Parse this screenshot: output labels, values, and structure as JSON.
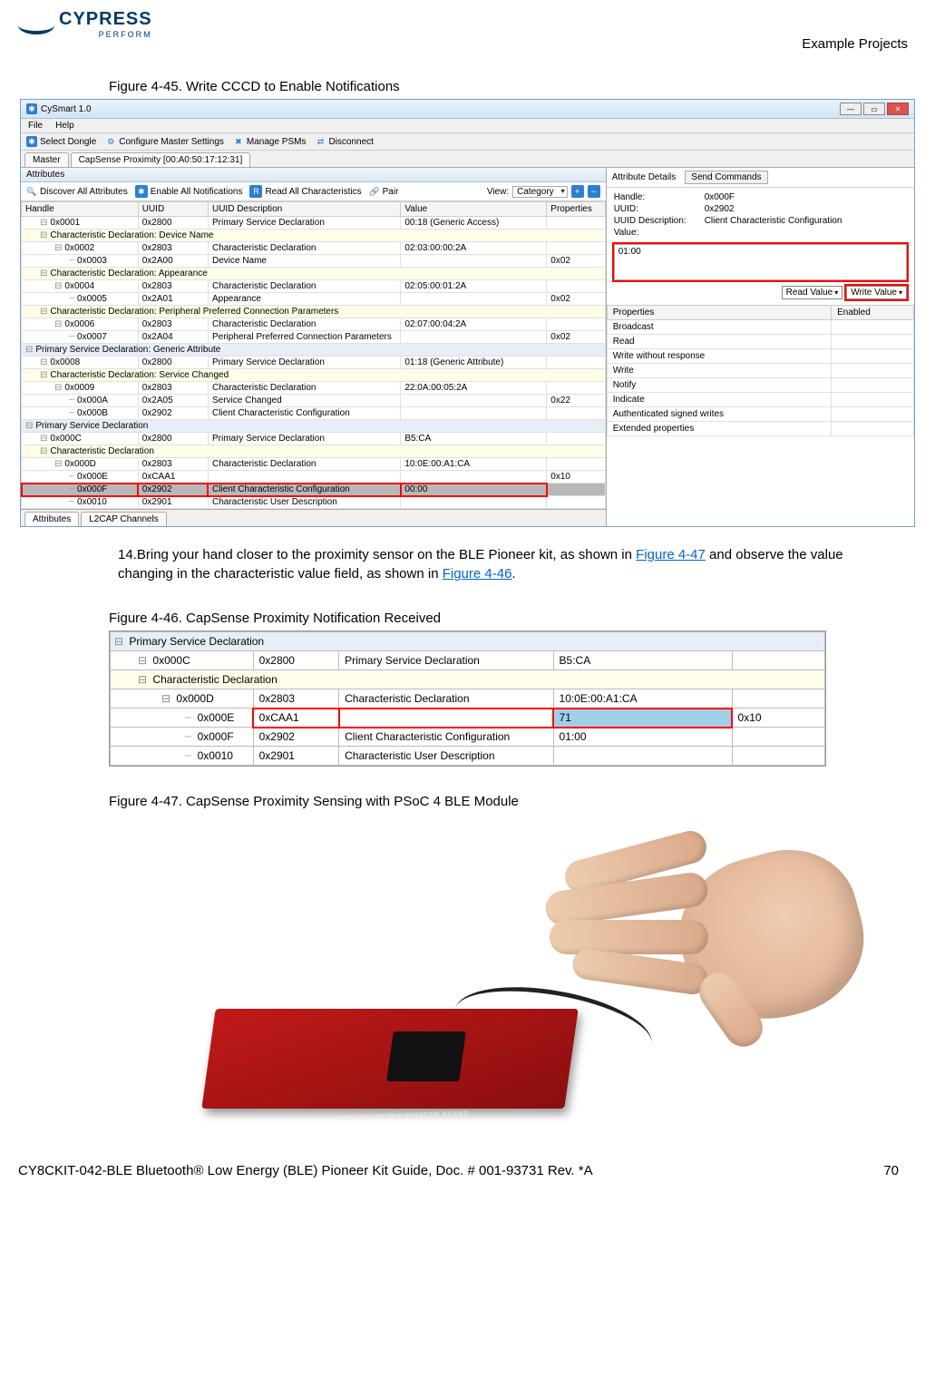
{
  "header": {
    "brand": "CYPRESS",
    "brand_sub": "PERFORM",
    "section": "Example Projects"
  },
  "figure45": {
    "caption": "Figure 4-45.  Write CCCD to Enable Notifications",
    "title": "CySmart 1.0",
    "menubar": [
      "File",
      "Help"
    ],
    "toolbar": [
      {
        "icon": "bluetooth-icon",
        "label": "Select Dongle"
      },
      {
        "icon": "gear-icon",
        "label": "Configure Master Settings"
      },
      {
        "icon": "tools-icon",
        "label": "Manage PSMs"
      },
      {
        "icon": "disconnect-icon",
        "label": "Disconnect"
      }
    ],
    "master_tabs": [
      "Master",
      "CapSense Proximity [00:A0:50:17:12:31]"
    ],
    "attributes_header": "Attributes",
    "attr_toolbar": [
      "Discover All Attributes",
      "Enable All Notifications",
      "Read All Characteristics",
      "Pair",
      "View:"
    ],
    "view_value": "Category",
    "columns": [
      "Handle",
      "UUID",
      "UUID Description",
      "Value",
      "Properties"
    ],
    "rows": [
      {
        "indent": 1,
        "group": false,
        "cells": [
          "0x0001",
          "0x2800",
          "Primary Service Declaration",
          "00:18 (Generic Access)",
          ""
        ]
      },
      {
        "indent": 1,
        "group": true,
        "span": "Characteristic Declaration: Device Name"
      },
      {
        "indent": 2,
        "group": false,
        "cells": [
          "0x0002",
          "0x2803",
          "Characteristic Declaration",
          "02:03:00:00:2A",
          ""
        ]
      },
      {
        "indent": 3,
        "group": false,
        "cells": [
          "0x0003",
          "0x2A00",
          "Device Name",
          "",
          "0x02"
        ]
      },
      {
        "indent": 1,
        "group": true,
        "span": "Characteristic Declaration: Appearance"
      },
      {
        "indent": 2,
        "group": false,
        "cells": [
          "0x0004",
          "0x2803",
          "Characteristic Declaration",
          "02:05:00:01:2A",
          ""
        ]
      },
      {
        "indent": 3,
        "group": false,
        "cells": [
          "0x0005",
          "0x2A01",
          "Appearance",
          "",
          "0x02"
        ]
      },
      {
        "indent": 1,
        "group": true,
        "span": "Characteristic Declaration: Peripheral Preferred Connection Parameters"
      },
      {
        "indent": 2,
        "group": false,
        "cells": [
          "0x0006",
          "0x2803",
          "Characteristic Declaration",
          "02:07:00:04:2A",
          ""
        ]
      },
      {
        "indent": 3,
        "group": false,
        "cells": [
          "0x0007",
          "0x2A04",
          "Peripheral Preferred Connection Parameters",
          "",
          "0x02"
        ]
      },
      {
        "indent": 0,
        "groupblue": true,
        "span": "Primary Service Declaration: Generic Attribute"
      },
      {
        "indent": 1,
        "group": false,
        "cells": [
          "0x0008",
          "0x2800",
          "Primary Service Declaration",
          "01:18 (Generic Attribute)",
          ""
        ]
      },
      {
        "indent": 1,
        "group": true,
        "span": "Characteristic Declaration: Service Changed"
      },
      {
        "indent": 2,
        "group": false,
        "cells": [
          "0x0009",
          "0x2803",
          "Characteristic Declaration",
          "22:0A:00:05:2A",
          ""
        ]
      },
      {
        "indent": 3,
        "group": false,
        "cells": [
          "0x000A",
          "0x2A05",
          "Service Changed",
          "",
          "0x22"
        ]
      },
      {
        "indent": 3,
        "group": false,
        "cells": [
          "0x000B",
          "0x2902",
          "Client Characteristic Configuration",
          "",
          ""
        ]
      },
      {
        "indent": 0,
        "groupblue": true,
        "span": "Primary Service Declaration"
      },
      {
        "indent": 1,
        "group": false,
        "cells": [
          "0x000C",
          "0x2800",
          "Primary Service Declaration",
          "B5:CA",
          ""
        ]
      },
      {
        "indent": 1,
        "group": true,
        "span": "Characteristic Declaration"
      },
      {
        "indent": 2,
        "group": false,
        "cells": [
          "0x000D",
          "0x2803",
          "Characteristic Declaration",
          "10:0E:00:A1:CA",
          ""
        ]
      },
      {
        "indent": 3,
        "group": false,
        "cells": [
          "0x000E",
          "0xCAA1",
          "",
          "",
          "0x10"
        ]
      },
      {
        "indent": 3,
        "group": false,
        "selected": true,
        "red": true,
        "cells": [
          "0x000F",
          "0x2902",
          "Client Characteristic Configuration",
          "00:00",
          ""
        ]
      },
      {
        "indent": 3,
        "group": false,
        "cells": [
          "0x0010",
          "0x2901",
          "Characteristic User Description",
          "",
          ""
        ]
      }
    ],
    "bottom_tabs": [
      "Attributes",
      "L2CAP Channels"
    ],
    "details": {
      "heading": "Attribute Details",
      "send_cmd": "Send Commands",
      "fields": [
        {
          "label": "Handle:",
          "value": "0x000F"
        },
        {
          "label": "UUID:",
          "value": "0x2902"
        },
        {
          "label": "UUID Description:",
          "value": "Client Characteristic Configuration"
        },
        {
          "label": "Value:",
          "value": ""
        }
      ],
      "value_text": "01:00",
      "read_label": "Read Value",
      "write_label": "Write Value",
      "prop_cols": [
        "Properties",
        "Enabled"
      ],
      "properties": [
        "Broadcast",
        "Read",
        "Write without response",
        "Write",
        "Notify",
        "Indicate",
        "Authenticated signed writes",
        "Extended properties"
      ]
    }
  },
  "body": {
    "step_num": "14.",
    "step_text_a": "Bring your hand closer to the proximity sensor on the BLE Pioneer kit, as shown in ",
    "link_447": "Figure 4-47",
    "step_text_b": " and observe the value changing in the characteristic value field, as shown in ",
    "link_446": "Figure 4-46",
    "step_text_c": "."
  },
  "figure46": {
    "caption": "Figure 4-46.  CapSense Proximity Notification Received",
    "rows": [
      {
        "cls": "blue",
        "indent": 0,
        "span": "Primary Service Declaration"
      },
      {
        "indent": 1,
        "cells": [
          "0x000C",
          "0x2800",
          "Primary Service Declaration",
          "B5:CA",
          ""
        ]
      },
      {
        "cls": "yellow",
        "indent": 1,
        "span": "Characteristic Declaration"
      },
      {
        "indent": 2,
        "cells": [
          "0x000D",
          "0x2803",
          "Characteristic Declaration",
          "10:0E:00:A1:CA",
          ""
        ]
      },
      {
        "indent": 3,
        "red": true,
        "cells": [
          "0x000E",
          "0xCAA1",
          "",
          "71",
          "0x10"
        ],
        "hl_col": 3
      },
      {
        "indent": 3,
        "cells": [
          "0x000F",
          "0x2902",
          "Client Characteristic Configuration",
          "01:00",
          ""
        ]
      },
      {
        "indent": 3,
        "cells": [
          "0x0010",
          "0x2901",
          "Characteristic User Description",
          "",
          ""
        ]
      }
    ]
  },
  "figure47": {
    "caption": "Figure 4-47.  CapSense Proximity Sensing with PSoC 4 BLE Module"
  },
  "footer": {
    "doc": "CY8CKIT-042-BLE Bluetooth® Low Energy (BLE) Pioneer Kit Guide, Doc. # 001-93731 Rev. *A",
    "page": "70"
  }
}
